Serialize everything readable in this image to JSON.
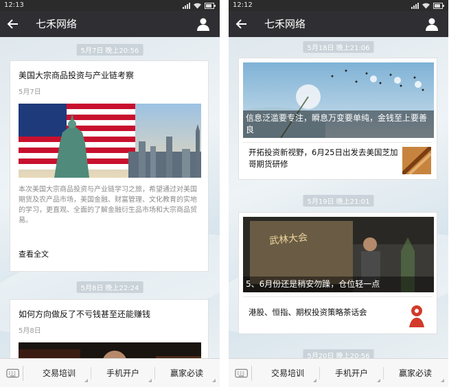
{
  "phones": {
    "left": {
      "status_time": "12:13",
      "title": "七禾网络",
      "stamps": [
        "5月7日 晚上20:56",
        "5月8日 晚上22:24"
      ],
      "article1": {
        "title": "美国大宗商品投资与产业链考察",
        "date": "5月7日",
        "desc": "本次美国大宗商品投资与产业链学习之旅，希望通过对美国期货及农产品市场，美国金融、财富管理、文化教育的实地的学习，更直观、全面的了解金融衍生品市场和大宗商品贸易。",
        "more": "查看全文"
      },
      "article2": {
        "title": "如何方向做反了不亏钱甚至还能赚钱",
        "date": "5月8日"
      }
    },
    "right": {
      "status_time": "12:12",
      "title": "七禾网络",
      "stamps": [
        "5月18日 晚上21:06",
        "5月19日 晚上21:01",
        "5月20日 晚上20:56"
      ],
      "group1": {
        "cover_title": "信息泛滥要专注，瞬息万变要单纯，金钱至上要善良",
        "item": "开拓投资新视野，6月25日出发去美国芝加哥期货研修"
      },
      "group2": {
        "cover_title": "5、6月份还是稍安勿躁，仓位轻一点",
        "item": "港股、恒指、期权投资策略茶话会",
        "cover_banner": "武林大会"
      }
    }
  },
  "menu": [
    "交易培训",
    "手机开户",
    "赢家必读"
  ],
  "icons": {
    "back": "arrow-left-icon",
    "person": "person-icon",
    "keyboard": "keyboard-icon"
  },
  "colors": {
    "titlebar": "#2f2f33",
    "statusbar": "#2b2b2b",
    "timestamp": "#c9d3d9"
  }
}
